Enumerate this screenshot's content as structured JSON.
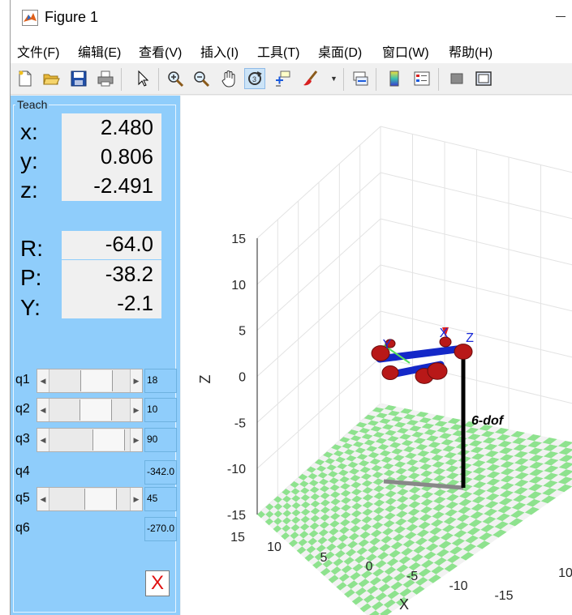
{
  "window": {
    "title": "Figure 1"
  },
  "menu": [
    "文件(F)",
    "编辑(E)",
    "查看(V)",
    "插入(I)",
    "工具(T)",
    "桌面(D)",
    "窗口(W)",
    "帮助(H)"
  ],
  "toolbar": {
    "icons": [
      "new-figure-icon",
      "open-file-icon",
      "save-icon",
      "print-icon",
      "pointer-icon",
      "zoom-in-icon",
      "zoom-out-icon",
      "pan-icon",
      "rotate-3d-icon",
      "data-cursor-icon",
      "brush-icon",
      "link-plot-icon",
      "colorbar-icon",
      "legend-icon",
      "hide-plot-tools-icon",
      "show-plot-tools-icon"
    ],
    "active": "rotate-3d-icon"
  },
  "teach": {
    "title": "Teach",
    "position": [
      {
        "label": "x:",
        "value": "2.480"
      },
      {
        "label": "y:",
        "value": "0.806"
      },
      {
        "label": "z:",
        "value": "-2.491"
      }
    ],
    "orientation": [
      {
        "label": "R:",
        "value": "-64.0"
      },
      {
        "label": "P:",
        "value": "-38.2"
      },
      {
        "label": "Y:",
        "value": "-2.1"
      }
    ],
    "joints": [
      {
        "label": "q1",
        "value": "18",
        "slider": true,
        "fraction": 0.62
      },
      {
        "label": "q2",
        "value": "10",
        "slider": true,
        "fraction": 0.6
      },
      {
        "label": "q3",
        "value": "90",
        "slider": true,
        "fraction": 0.85
      },
      {
        "label": "q4",
        "value": "-342.0",
        "slider": false
      },
      {
        "label": "q5",
        "value": "45",
        "slider": true,
        "fraction": 0.7
      },
      {
        "label": "q6",
        "value": "-270.0",
        "slider": false
      }
    ],
    "close_label": "X"
  },
  "chart_data": {
    "type": "3d-robot-plot",
    "zlabel": "Z",
    "xlabel": "X",
    "z_ticks": [
      "15",
      "10",
      "5",
      "0",
      "-5",
      "-10",
      "-15"
    ],
    "x_ticks": [
      "15",
      "10",
      "5",
      "0",
      "-5",
      "-10",
      "-15"
    ],
    "y_ticks": [
      "10"
    ],
    "zlim": [
      -15,
      15
    ],
    "xlim": [
      -15,
      15
    ],
    "grid": true,
    "robot_label": "6-dof",
    "frame_labels": [
      "Y",
      "X",
      "Z"
    ],
    "colors": {
      "floor_a": "#8ee28e",
      "floor_b": "#f2f2f2",
      "link": "#1428c8",
      "joint": "#b81818",
      "base": "#000000"
    }
  }
}
